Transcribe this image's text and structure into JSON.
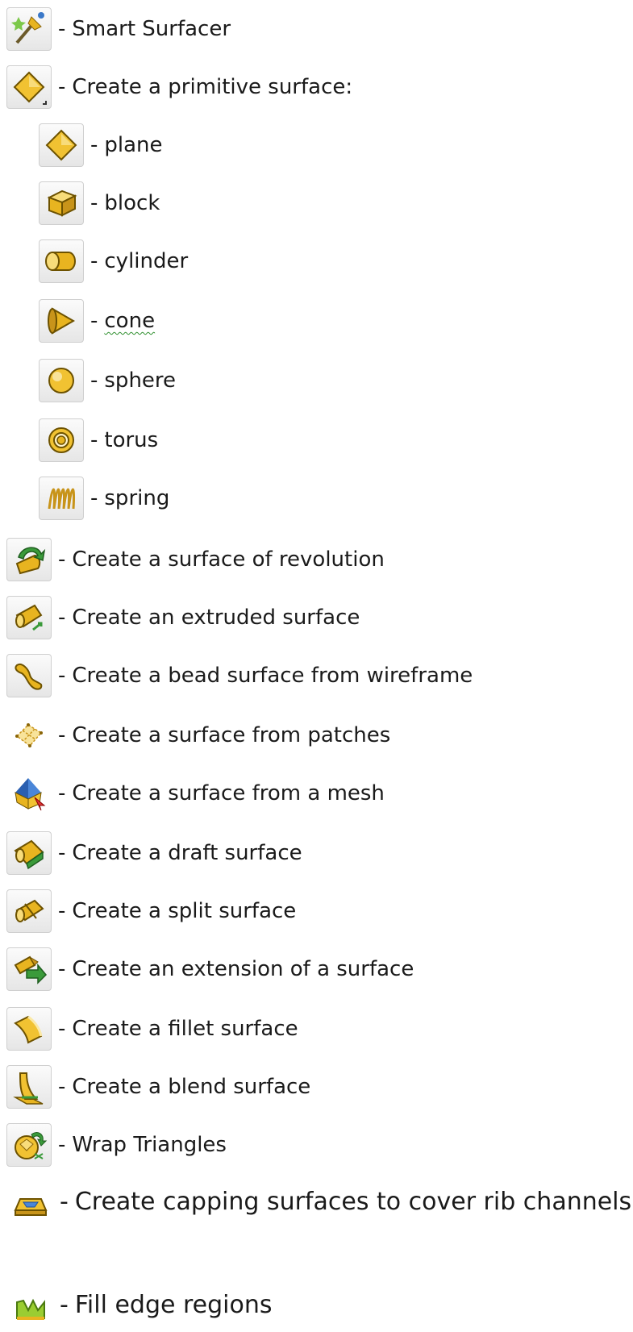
{
  "items": [
    {
      "name": "smart-surfacer",
      "icon": "smart-surfacer-icon",
      "label": "Smart Surfacer"
    },
    {
      "name": "primitive-surface",
      "icon": "diamond-plane-dropdown-icon",
      "label": "Create a primitive surface:"
    },
    {
      "name": "plane",
      "icon": "plane-icon",
      "label": "plane"
    },
    {
      "name": "block",
      "icon": "block-icon",
      "label": "block"
    },
    {
      "name": "cylinder",
      "icon": "cylinder-icon",
      "label": "cylinder"
    },
    {
      "name": "cone",
      "icon": "cone-icon",
      "label": "cone"
    },
    {
      "name": "sphere",
      "icon": "sphere-icon",
      "label": "sphere"
    },
    {
      "name": "torus",
      "icon": "torus-icon",
      "label": "torus"
    },
    {
      "name": "spring",
      "icon": "spring-icon",
      "label": "spring"
    },
    {
      "name": "revolution",
      "icon": "revolution-icon",
      "label": "Create a surface of revolution"
    },
    {
      "name": "extruded",
      "icon": "extrude-icon",
      "label": "Create an extruded surface"
    },
    {
      "name": "bead",
      "icon": "bead-icon",
      "label": "Create a bead surface from wireframe"
    },
    {
      "name": "patches",
      "icon": "patches-icon",
      "label": "Create a surface from patches"
    },
    {
      "name": "mesh",
      "icon": "mesh-icon",
      "label": "Create a surface from a mesh"
    },
    {
      "name": "draft",
      "icon": "draft-icon",
      "label": "Create a draft surface"
    },
    {
      "name": "split",
      "icon": "split-icon",
      "label": "Create a split surface"
    },
    {
      "name": "extension",
      "icon": "extension-icon",
      "label": "Create an extension of a surface"
    },
    {
      "name": "fillet",
      "icon": "fillet-icon",
      "label": "Create a fillet surface"
    },
    {
      "name": "blend",
      "icon": "blend-icon",
      "label": "Create a blend surface"
    },
    {
      "name": "wrap",
      "icon": "wrap-triangles-icon",
      "label": "Wrap Triangles"
    },
    {
      "name": "capping",
      "icon": "capping-icon",
      "label": "Create capping surfaces to cover rib channels"
    },
    {
      "name": "fill-edge",
      "icon": "fill-edge-icon",
      "label": "Fill edge regions"
    }
  ],
  "separator": "-",
  "colors": {
    "icon_gold": "#e8b420",
    "icon_gold_dark": "#8a6508",
    "icon_green": "#3a9a3a",
    "spellcheck_underline": "#2f8f2f"
  }
}
